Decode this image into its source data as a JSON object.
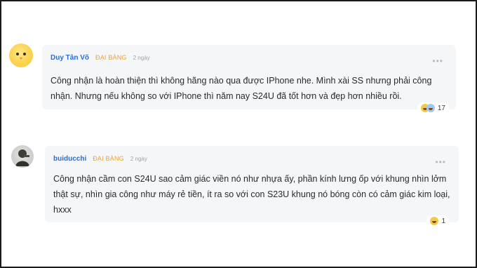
{
  "comments": [
    {
      "author": "Duy Tân Võ",
      "rank": "ĐẠI BÀNG",
      "time": "2 ngày",
      "more": "•••",
      "text": "Công nhận là hoàn thiện thì không hãng nào qua được IPhone nhe. Mình xài SS nhưng phải công nhận. Nhưng nếu không so với IPhone thì năm nay S24U đã tốt hơn và đẹp hơn nhiều rồi.",
      "reaction_icon": "laugh-cry-emoji-icon",
      "reaction_count": "17"
    },
    {
      "author": "buiducchi",
      "rank": "ĐẠI BÀNG",
      "time": "2 ngày",
      "more": "•••",
      "text": "Công nhận cầm con S24U sao cảm giác viền nó như nhựa ấy, phần kính lưng ốp với khung nhìn lởm thật sự, nhìn gia công như máy rẻ tiền, ít ra so với con S23U khung nó bóng còn có cảm giác kim loại, hxxx",
      "reaction_icon": "laugh-emoji-icon",
      "reaction_count": "1"
    }
  ],
  "colors": {
    "author": "#2d6cd4",
    "rank": "#e8a33d",
    "bubble": "#f5f6f8"
  }
}
